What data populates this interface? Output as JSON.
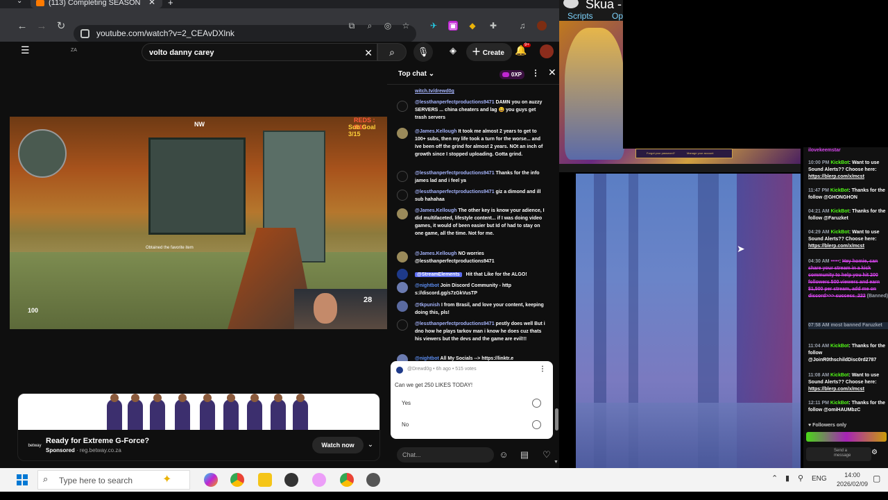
{
  "browser": {
    "tab_title": "(113) Completing SEASON",
    "url": "youtube.com/watch?v=2_CEAvDXlnk"
  },
  "youtube": {
    "logo_text": "ZA",
    "search_query": "volto danny carey",
    "create_label": "Create",
    "notifications_count": "9+"
  },
  "video": {
    "hud_reds": "REDS : 9/10",
    "hud_subgoal": "Sub Goal 3/15",
    "hud_compass": "NW",
    "hud_ammo": "28",
    "hud_health": "100",
    "overlay_text": "Obtained the favorite item"
  },
  "ad": {
    "title": "Ready for Extreme G-Force?",
    "sponsored": "Sponsored",
    "domain": "reg.betway.co.za",
    "logo": "betway",
    "watch_label": "Watch now"
  },
  "chat": {
    "mode": "Top chat",
    "xp": "0XP",
    "messages": [
      {
        "author": "",
        "text": "witch.tv/drewd0g"
      },
      {
        "author": "@lessthanperfectproductions9471",
        "text": "DAMN you on auzzy SERVERS ... china cheaters and lag 😀 you guys get trash servers"
      },
      {
        "author": "@James.Kellough",
        "text": "It took me almost 2 years to get to 100+ subs, then my life took a turn for the worse... and Ive been off the grind for almost 2 years. NOt an inch of growth since I stopped uploading. Gotta grind."
      },
      {
        "author": "@lessthanperfectproductions9471",
        "text": "Thanks for the info james lad and i feel ya"
      },
      {
        "author": "@lessthanperfectproductions9471",
        "text": "giz a dimond and ill sub hahahaa"
      },
      {
        "author": "@James.Kellough",
        "text": "The other key is know your adience, I did multifaceted, lifestyle content... if I was doing video games, it would of been easier but Id of had to stay on one game, all the time. Not for me."
      },
      {
        "author": "@James.Kellough",
        "text": "NO worries @lessthanperfectproductions9471"
      },
      {
        "author": "@StreamElements",
        "text": "Hit that Like for the ALGO!"
      },
      {
        "author": "@nightbot",
        "text": "Join Discord Community - http s://discord.gg/s7zGkVusTP"
      },
      {
        "author": "@tkpunish",
        "text": "I from Brasil, and love your content, keeping doing this, pls!"
      },
      {
        "author": "@lessthanperfectproductions9471",
        "text": "pestly does well But i dno how he plays tarkov man i know he does cuz thats his viewers but the devs and the game are evil!!!"
      },
      {
        "author": "@nightbot",
        "text": "All My Socials --> https://linktr.e"
      }
    ],
    "poll": {
      "meta": "@Drewd0g • 6h ago • 515 votes",
      "question": "Can we get 250 LIKES TODAY!",
      "options": [
        "Yes",
        "No"
      ]
    },
    "input_placeholder": "Chat..."
  },
  "skua": {
    "title": "Skua -",
    "menu": [
      "Scripts",
      "Op"
    ],
    "art_link1": "Forgot your password?",
    "art_link2": "Manage your account"
  },
  "kick": {
    "header_user": "ilovekeemstar",
    "messages": [
      {
        "time": "10:00 PM",
        "user": "KickBot",
        "text": "Want to use Sound Alerts?? Choose here:",
        "link": "https://blerp.com/x/mcst"
      },
      {
        "time": "11:47 PM",
        "user": "KickBot",
        "text": "Thanks for the follow @GHONGHON",
        "link": ""
      },
      {
        "time": "04:21 AM",
        "user": "KickBot",
        "text": "Thanks for the follow @Faruzket",
        "link": ""
      },
      {
        "time": "04:29 AM",
        "user": "KickBot",
        "text": "Want to use Sound Alerts?? Choose here:",
        "link": "https://blerp.com/x/mcst"
      },
      {
        "time": "04:30 AM",
        "user": "",
        "text": "Hey homie, can share your stream in a kick community to help you hit 200 followers 500 viewers and earn $1,500 per stream, add me on discord>>> success_222",
        "link": "",
        "banned": "(Banned)"
      },
      {
        "time": "07:58 AM",
        "user": "",
        "text": "most banned Faruzket",
        "link": ""
      },
      {
        "time": "11:04 AM",
        "user": "KickBot",
        "text": "Thanks for the follow @JoinR0thschildDisc0rd2787",
        "link": ""
      },
      {
        "time": "11:08 AM",
        "user": "KickBot",
        "text": "Want to use Sound Alerts?? Choose here:",
        "link": "https://blerp.com/x/mcst"
      },
      {
        "time": "12:11 PM",
        "user": "KickBot",
        "text": "Thanks for the follow @omiHAUMbzC",
        "link": ""
      }
    ],
    "followers_only": "Followers only",
    "send_placeholder": "Send a message"
  },
  "taskbar": {
    "search_placeholder": "Type here to search",
    "lang": "ENG",
    "time": "14:00",
    "date": "2026/02/09"
  }
}
